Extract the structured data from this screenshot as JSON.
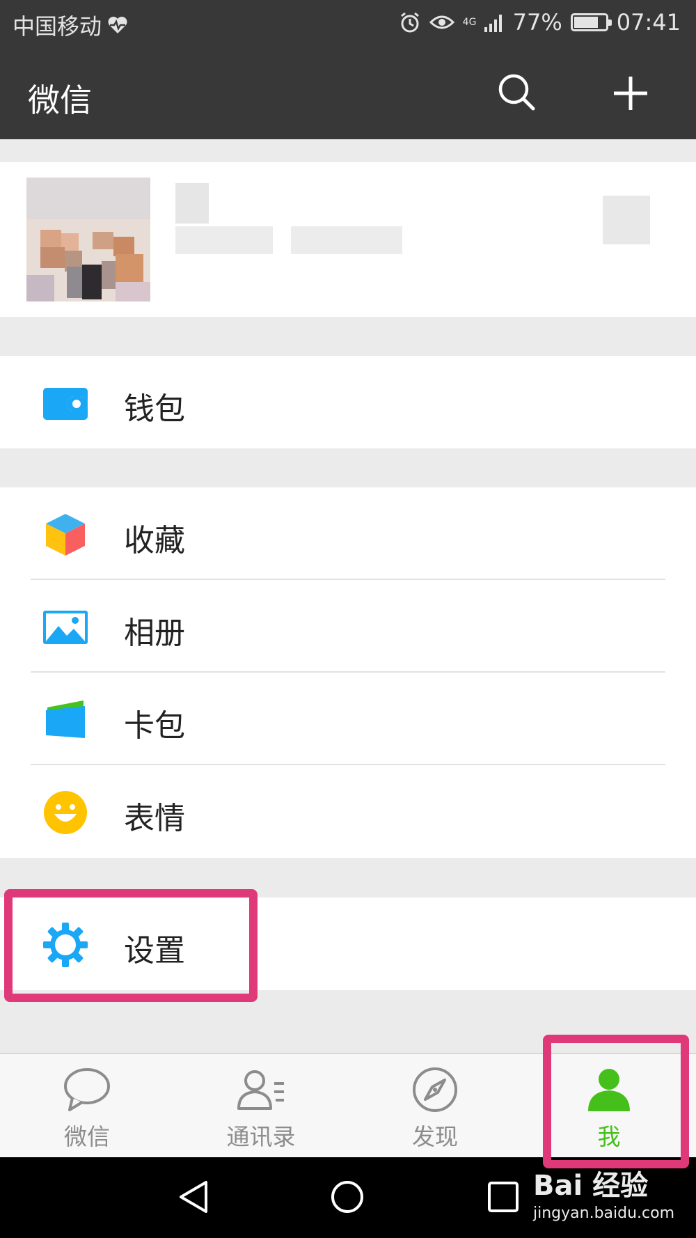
{
  "status_bar": {
    "carrier": "中国移动",
    "network": "4G",
    "battery_percent": "77%",
    "battery_level": 0.77,
    "time": "07:41",
    "icons": [
      "heart-rate-icon",
      "alarm-icon",
      "eye-icon",
      "signal-icon",
      "battery-icon"
    ]
  },
  "header": {
    "title": "微信",
    "search_icon": "search-icon",
    "add_icon": "plus-icon"
  },
  "menu": {
    "wallet": {
      "label": "钱包",
      "icon": "wallet-icon",
      "color": "#1aa7f5"
    },
    "favorites": {
      "label": "收藏",
      "icon": "cube-icon"
    },
    "album": {
      "label": "相册",
      "icon": "photo-icon",
      "color": "#1aa7f5"
    },
    "cards": {
      "label": "卡包",
      "icon": "card-icon",
      "color": "#1aa7f5"
    },
    "stickers": {
      "label": "表情",
      "icon": "smiley-icon",
      "color": "#ffc300"
    },
    "settings": {
      "label": "设置",
      "icon": "gear-icon",
      "color": "#1aa7f5"
    }
  },
  "tabs": [
    {
      "label": "微信",
      "icon": "chat-bubble-icon",
      "active": false
    },
    {
      "label": "通讯录",
      "icon": "contacts-icon",
      "active": false
    },
    {
      "label": "发现",
      "icon": "compass-icon",
      "active": false
    },
    {
      "label": "我",
      "icon": "person-icon",
      "active": true
    }
  ],
  "colors": {
    "header_bg": "#383838",
    "accent_green": "#45c01a",
    "highlight": "#e0397a",
    "icon_blue": "#1aa7f5"
  },
  "watermark": {
    "brand": "Bai 经验",
    "url": "jingyan.baidu.com"
  }
}
